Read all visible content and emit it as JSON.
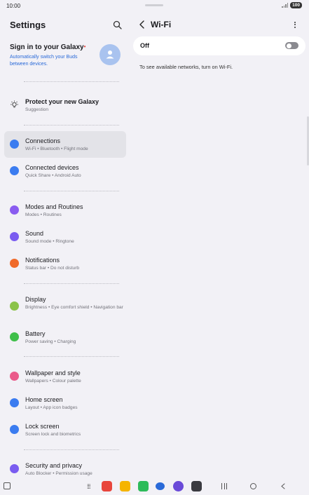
{
  "status": {
    "time": "10:00",
    "battery": "100"
  },
  "left": {
    "title": "Settings",
    "account": {
      "title": "Sign in to your Galaxy",
      "subtitle": "Automatically switch your Buds between devices."
    },
    "suggestion": {
      "title": "Protect your new Galaxy",
      "subtitle": "Suggestion"
    },
    "items": [
      {
        "title": "Connections",
        "subtitle": "Wi-Fi  •  Bluetooth  •  Flight mode",
        "color": "#3b7cf0"
      },
      {
        "title": "Connected devices",
        "subtitle": "Quick Share  •  Android Auto",
        "color": "#3b7cf0"
      },
      {
        "title": "Modes and Routines",
        "subtitle": "Modes  •  Routines",
        "color": "#8a5cf0"
      },
      {
        "title": "Sound",
        "subtitle": "Sound mode  •  Ringtone",
        "color": "#7a5cf0"
      },
      {
        "title": "Notifications",
        "subtitle": "Status bar  •  Do not disturb",
        "color": "#f06a2a"
      },
      {
        "title": "Display",
        "subtitle": "Brightness  •  Eye comfort shield  •  Navigation bar",
        "color": "#8bc34a"
      },
      {
        "title": "Battery",
        "subtitle": "Power saving  •  Charging",
        "color": "#3fbf4a"
      },
      {
        "title": "Wallpaper and style",
        "subtitle": "Wallpapers  •  Colour palette",
        "color": "#ea5a8a"
      },
      {
        "title": "Home screen",
        "subtitle": "Layout  •  App icon badges",
        "color": "#3b7cf0"
      },
      {
        "title": "Lock screen",
        "subtitle": "Screen lock and biometrics",
        "color": "#3b7cf0"
      },
      {
        "title": "Security and privacy",
        "subtitle": "Auto Blocker  •  Permission usage",
        "color": "#7a5cf0"
      }
    ]
  },
  "right": {
    "title": "Wi-Fi",
    "switch_label": "Off",
    "hint": "To see available networks, turn on Wi-Fi."
  }
}
